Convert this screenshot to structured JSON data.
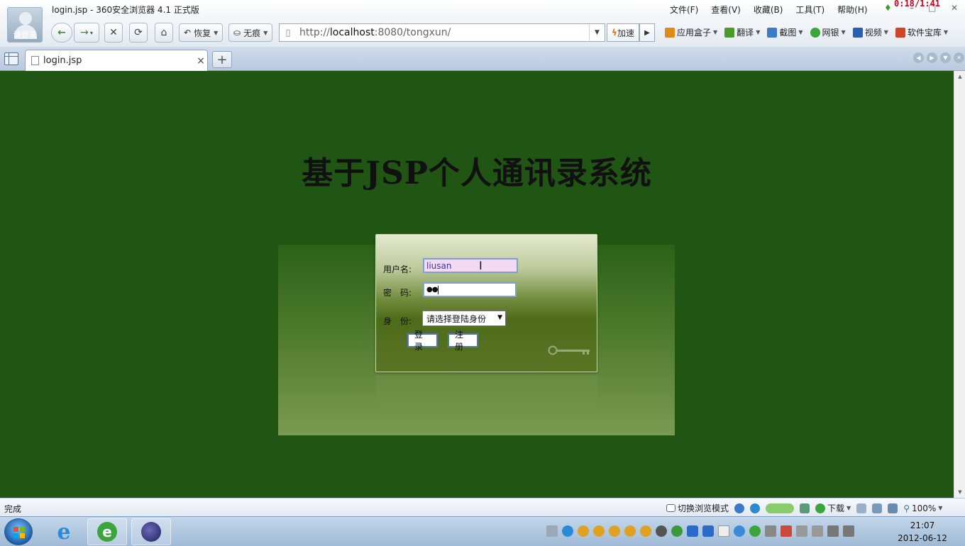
{
  "window": {
    "title": "login.jsp - 360安全浏览器 4.1 正式版",
    "avatar_label": "请登录",
    "timer": "0:18/1:41"
  },
  "menu": [
    "文件(F)",
    "查看(V)",
    "收藏(B)",
    "工具(T)",
    "帮助(H)"
  ],
  "toolbar": {
    "restore_label": "恢复",
    "incognito_label": "无痕",
    "url_prefix": "http://",
    "url_host": "localhost",
    "url_rest": ":8080/tongxun/",
    "speedup_label": "加速"
  },
  "plugins": [
    {
      "label": "应用盒子",
      "color": "#e08a1a"
    },
    {
      "label": "翻译",
      "color": "#4a9a2a"
    },
    {
      "label": "截图",
      "color": "#3a7ac8"
    },
    {
      "label": "网银",
      "color": "#3aa53a"
    },
    {
      "label": "视频",
      "color": "#2a5fb0"
    },
    {
      "label": "软件宝库",
      "color": "#d0452a"
    }
  ],
  "tab": {
    "label": "login.jsp"
  },
  "page": {
    "heading": "基于JSP个人通讯录系统",
    "username_label": "用户名:",
    "username_value": "liusan",
    "password_label": "密　码:",
    "password_value": "●●",
    "role_label": "身　份:",
    "role_selected": "请选择登陆身份",
    "login_button": "登录",
    "register_button": "注册",
    "background_color": "#215513"
  },
  "status": {
    "text": "完成",
    "mode_label": "切换浏览模式",
    "download_label": "下载",
    "zoom": "100%"
  },
  "clock": {
    "time": "21:07",
    "date": "2012-06-12"
  }
}
